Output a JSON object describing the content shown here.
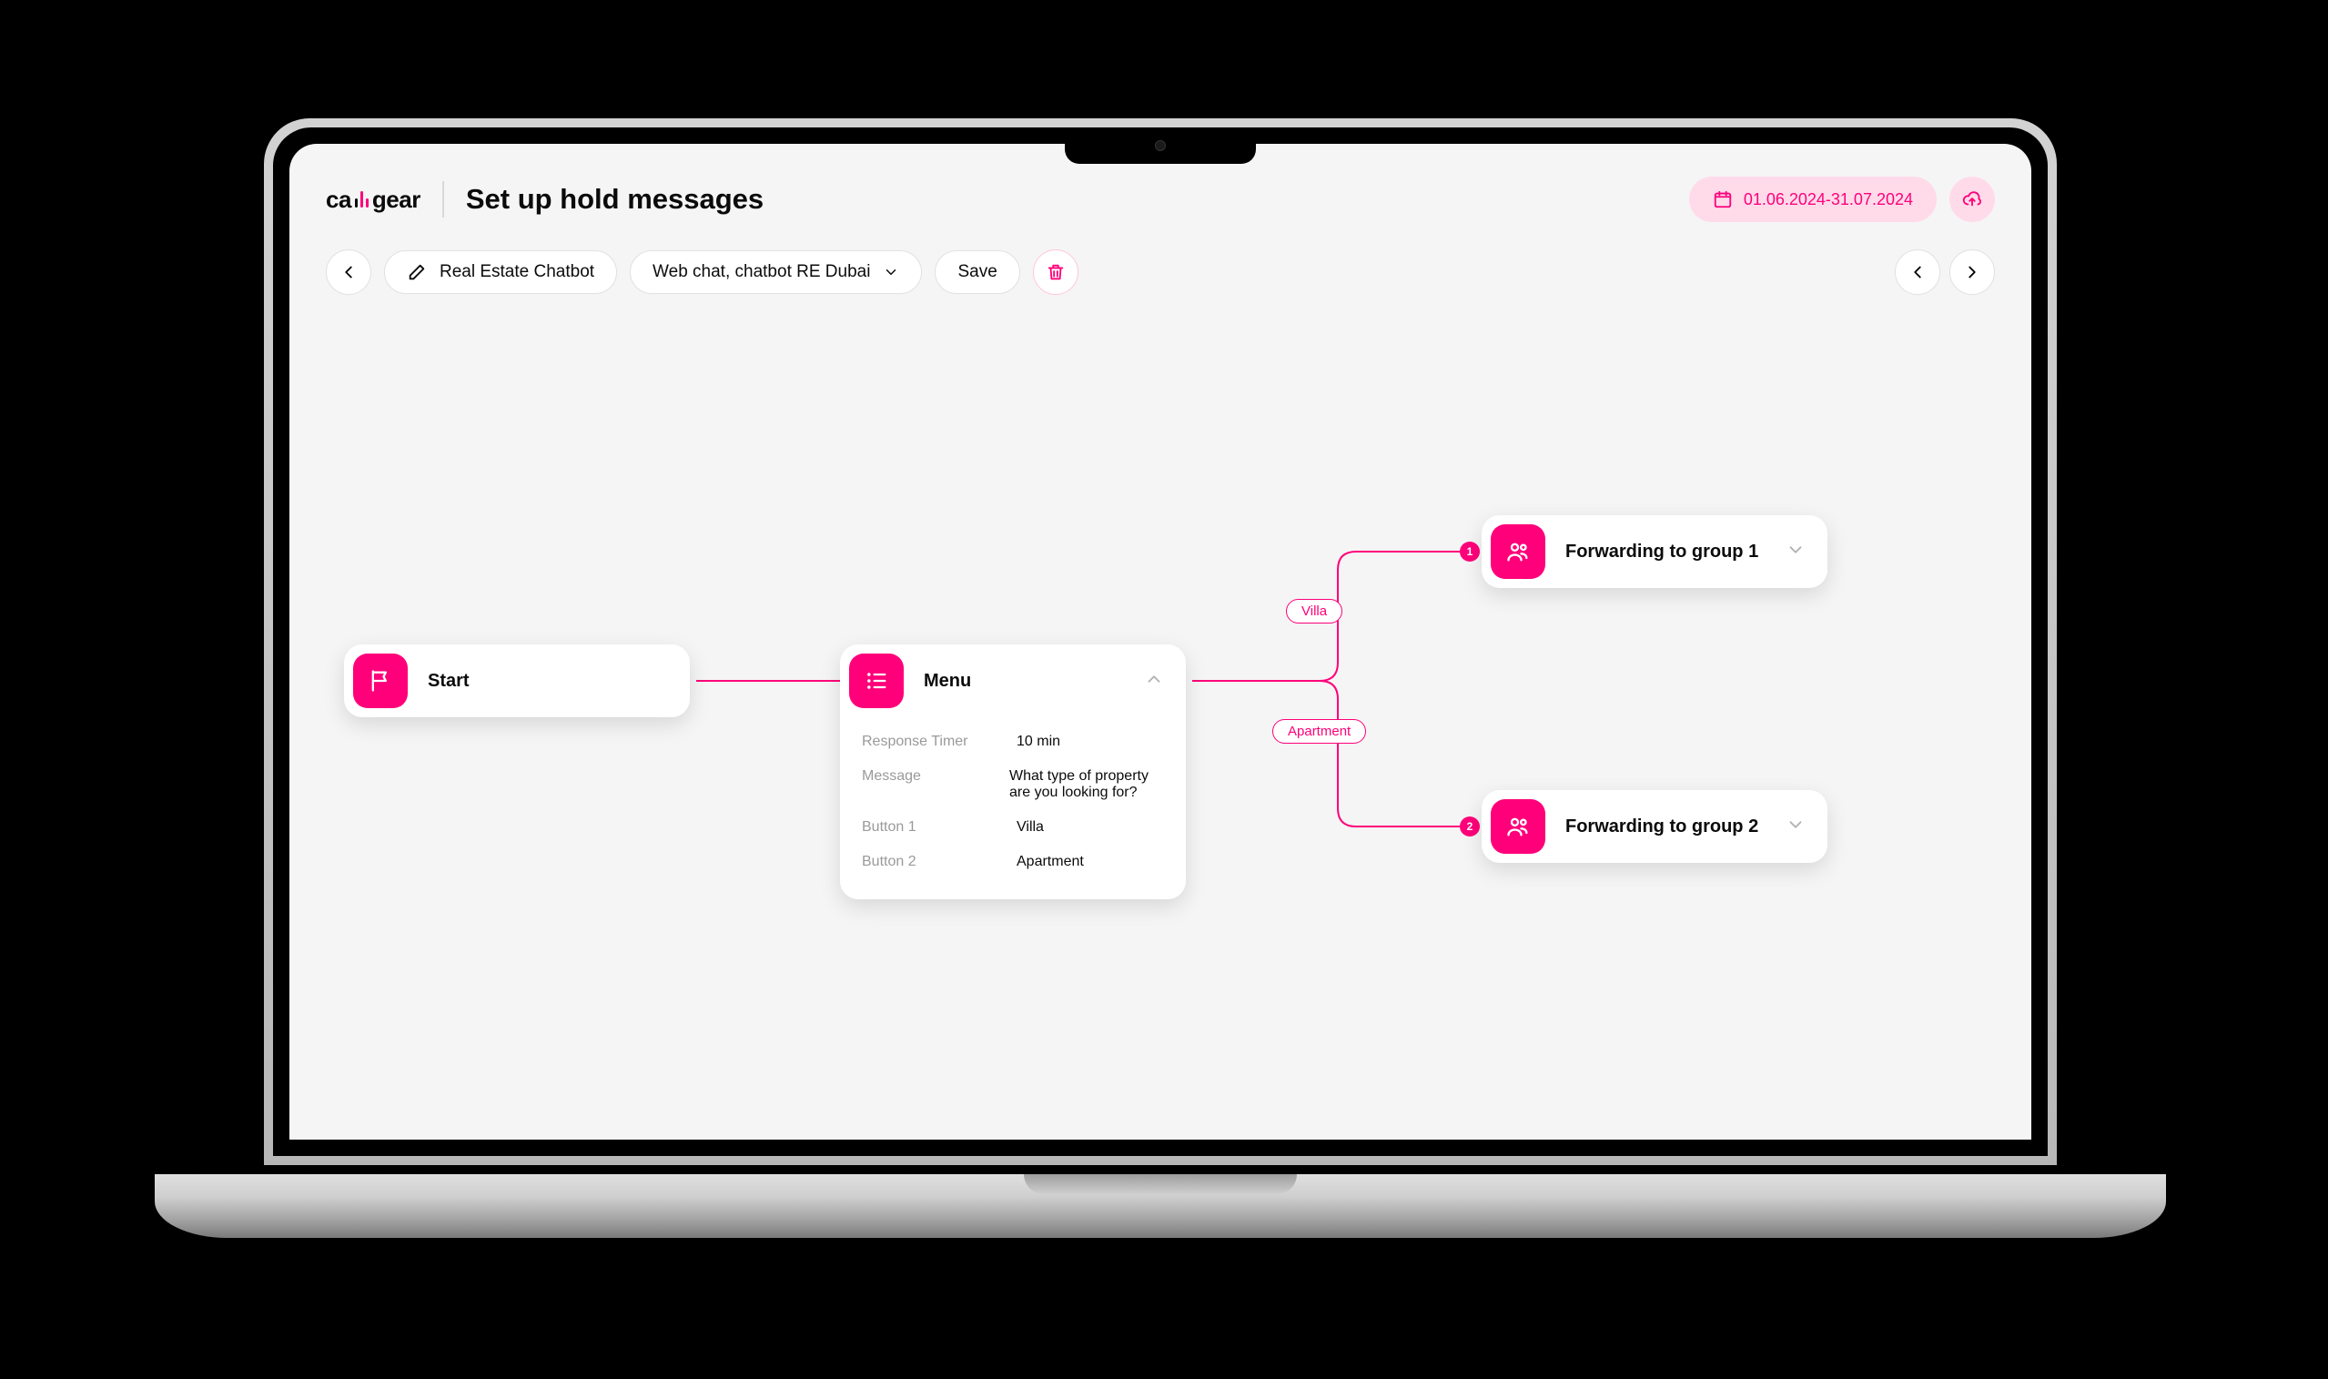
{
  "logo": {
    "left": "ca",
    "right": "gear"
  },
  "header": {
    "title": "Set up hold messages",
    "date_range": "01.06.2024-31.07.2024"
  },
  "toolbar": {
    "chatbot_name": "Real Estate Chatbot",
    "channel": "Web chat, chatbot RE Dubai",
    "save_label": "Save"
  },
  "flow": {
    "start": {
      "label": "Start"
    },
    "menu": {
      "label": "Menu",
      "response_timer_key": "Response Timer",
      "response_timer_val": "10 min",
      "message_key": "Message",
      "message_val": "What type of property are you looking for?",
      "button1_key": "Button 1",
      "button1_val": "Villa",
      "button2_key": "Button 2",
      "button2_val": "Apartment"
    },
    "branches": {
      "villa_tag": "Villa",
      "apartment_tag": "Apartment",
      "badge1": "1",
      "badge2": "2"
    },
    "fwd1": {
      "label": "Forwarding to group 1"
    },
    "fwd2": {
      "label": "Forwarding to group 2"
    }
  }
}
